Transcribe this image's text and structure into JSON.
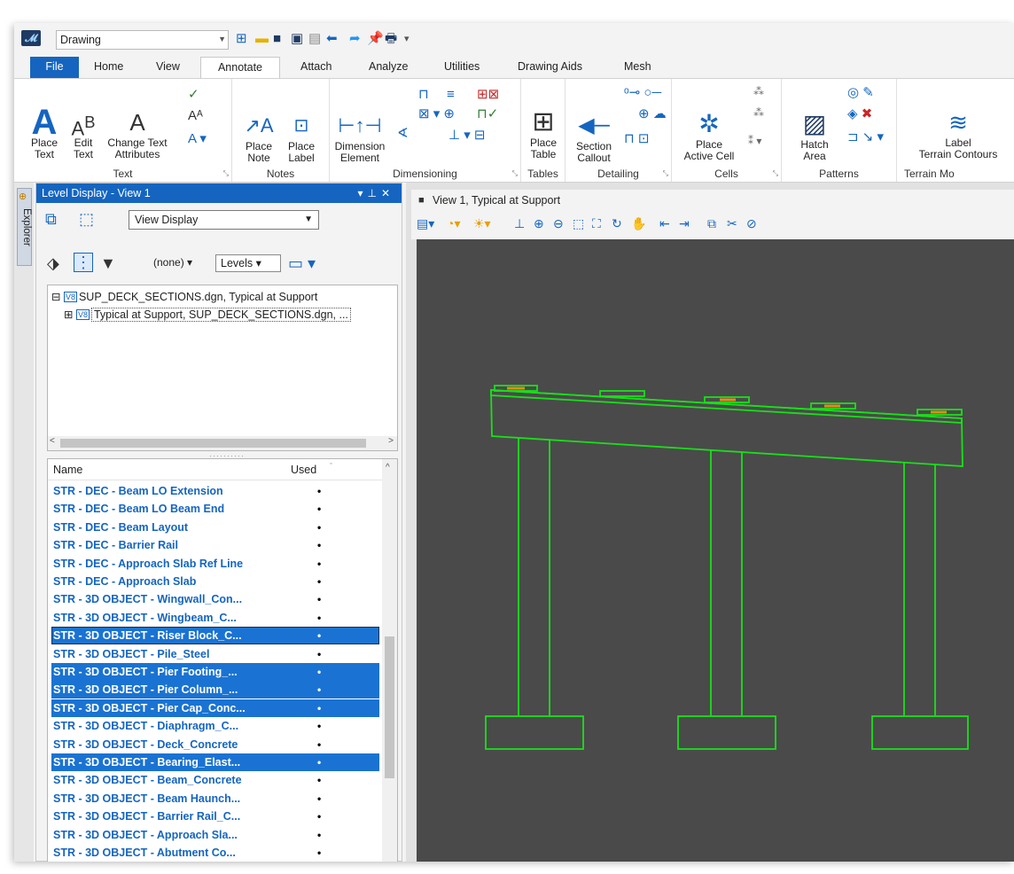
{
  "window": {
    "workspace": "Drawing",
    "tabs": [
      "File",
      "Home",
      "View",
      "Annotate",
      "Attach",
      "Analyze",
      "Utilities",
      "Drawing Aids",
      "Mesh"
    ],
    "active_tab": "Annotate"
  },
  "ribbon": {
    "groups": {
      "text": "Text",
      "notes": "Notes",
      "dimensioning": "Dimensioning",
      "tables": "Tables",
      "detailing": "Detailing",
      "cells": "Cells",
      "patterns": "Patterns",
      "terrain": "Terrain Mo"
    },
    "place_text": "Place\nText",
    "edit_text": "Edit\nText",
    "change_text_attr": "Change Text\nAttributes",
    "place_note": "Place\nNote",
    "place_label": "Place\nLabel",
    "dimension_element": "Dimension\nElement",
    "place_table": "Place\nTable",
    "section_callout": "Section\nCallout",
    "place_active_cell": "Place\nActive Cell",
    "hatch_area": "Hatch\nArea",
    "label_terrain": "Label\nTerrain Contours"
  },
  "level_panel": {
    "title": "Level Display - View 1",
    "explorer_label": "Explorer",
    "view_display": "View Display",
    "filter": "(none)",
    "levels_label": "Levels",
    "tree": [
      "SUP_DECK_SECTIONS.dgn, Typical at Support",
      "Typical at Support, SUP_DECK_SECTIONS.dgn, ..."
    ],
    "col_name": "Name",
    "col_used": "Used",
    "rows": [
      {
        "name": "STR - DEC - Beam LO Extension",
        "used": "•",
        "sel": false
      },
      {
        "name": "STR - DEC - Beam LO Beam End",
        "used": "•",
        "sel": false
      },
      {
        "name": "STR - DEC - Beam Layout",
        "used": "•",
        "sel": false
      },
      {
        "name": "STR - DEC - Barrier Rail",
        "used": "•",
        "sel": false
      },
      {
        "name": "STR - DEC - Approach Slab Ref Line",
        "used": "•",
        "sel": false
      },
      {
        "name": "STR - DEC - Approach Slab",
        "used": "•",
        "sel": false
      },
      {
        "name": "STR - 3D OBJECT - Wingwall_Con...",
        "used": "•",
        "sel": false
      },
      {
        "name": "STR - 3D OBJECT - Wingbeam_C...",
        "used": "•",
        "sel": false
      },
      {
        "name": "STR - 3D OBJECT - Riser Block_C...",
        "used": "•",
        "sel": true
      },
      {
        "name": "STR - 3D OBJECT - Pile_Steel",
        "used": "•",
        "sel": false
      },
      {
        "name": "STR - 3D OBJECT - Pier Footing_...",
        "used": "•",
        "sel": true
      },
      {
        "name": "STR - 3D OBJECT - Pier Column_...",
        "used": "•",
        "sel": true
      },
      {
        "name": "STR - 3D OBJECT - Pier Cap_Conc...",
        "used": "•",
        "sel": true
      },
      {
        "name": "STR - 3D OBJECT - Diaphragm_C...",
        "used": "•",
        "sel": false
      },
      {
        "name": "STR - 3D OBJECT - Deck_Concrete",
        "used": "•",
        "sel": false
      },
      {
        "name": "STR - 3D OBJECT - Bearing_Elast...",
        "used": "•",
        "sel": true
      },
      {
        "name": "STR - 3D OBJECT - Beam_Concrete",
        "used": "•",
        "sel": false
      },
      {
        "name": "STR - 3D OBJECT - Beam Haunch...",
        "used": "•",
        "sel": false
      },
      {
        "name": "STR - 3D OBJECT - Barrier Rail_C...",
        "used": "•",
        "sel": false
      },
      {
        "name": "STR - 3D OBJECT - Approach Sla...",
        "used": "•",
        "sel": false
      },
      {
        "name": "STR - 3D OBJECT - Abutment Co...",
        "used": "•",
        "sel": false
      }
    ]
  },
  "view": {
    "title": "View 1, Typical at Support",
    "background": "#4a4a4a",
    "line_color": "#19e019",
    "bearing_color": "#e8891a"
  }
}
